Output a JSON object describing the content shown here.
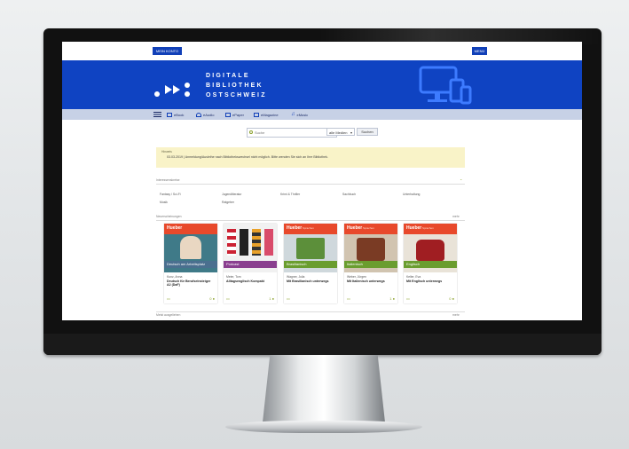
{
  "header": {
    "account_button": "MEIN KONTO",
    "menu_button": "MENÜ",
    "logo_lines": [
      "DIGITALE",
      "BIBLIOTHEK",
      "OSTSCHWEIZ"
    ],
    "brand_color": "#0f43c2"
  },
  "nav": {
    "items": [
      {
        "label": "eBook",
        "icon": "book-icon"
      },
      {
        "label": "eAudio",
        "icon": "headphones-icon"
      },
      {
        "label": "ePaper",
        "icon": "newspaper-icon"
      },
      {
        "label": "eMagazine",
        "icon": "magazine-icon"
      },
      {
        "label": "eMusic",
        "icon": "music-note-icon"
      }
    ]
  },
  "search": {
    "placeholder": "Suche",
    "select_value": "alle Medien",
    "button_label": "Suchen"
  },
  "notice": {
    "title": "Hinweis",
    "text": "03.03.2019 | Anmeldung/Ausleihe nach Bibliothekswechsel nicht möglich. Bitte wenden Sie sich an Ihre Bibliothek."
  },
  "sections": {
    "categories_label": "Interessenskreise",
    "categories": [
      "Fantasy / Sci-Fi",
      "Jugendliteratur",
      "Krimi & Thriller",
      "Sachbuch",
      "Unterhaltung",
      "Musik",
      "Ratgeber"
    ],
    "new_label": "Neuerscheinungen",
    "more_label": "mehr",
    "bottom_label": "Meist ausgeliehen",
    "bottom_more_label": "mehr"
  },
  "books": [
    {
      "author": "Kunz, Anna",
      "title": "Deutsch für Berufseinsteiger A2 (DaF)",
      "band": "Deutsch am Arbeitsplatz",
      "band_color": "#4a6f8f",
      "avail": "0"
    },
    {
      "author": "Meier, Tom",
      "title": "Alltagsenglisch Kompakt",
      "band": "Podcast",
      "band_color": "#8a3f8f",
      "avail": "1"
    },
    {
      "author": "Wagner, Julia",
      "title": "Mit Brasilianisch unterwegs",
      "band": "Brasilianisch",
      "band_color": "#6a9d2f",
      "avail": "0"
    },
    {
      "author": "Weber, Jürgen",
      "title": "Mit Italienisch unterwegs",
      "band": "Italienisch",
      "band_color": "#6a9d2f",
      "avail": "1"
    },
    {
      "author": "Keller, Eva",
      "title": "Mit Englisch unterwegs",
      "band": "Englisch",
      "band_color": "#6a9d2f",
      "avail": "0"
    }
  ],
  "cover_brand": "Hueber",
  "cover_sub": "Sprachen",
  "accent_color": "#8aa02a"
}
